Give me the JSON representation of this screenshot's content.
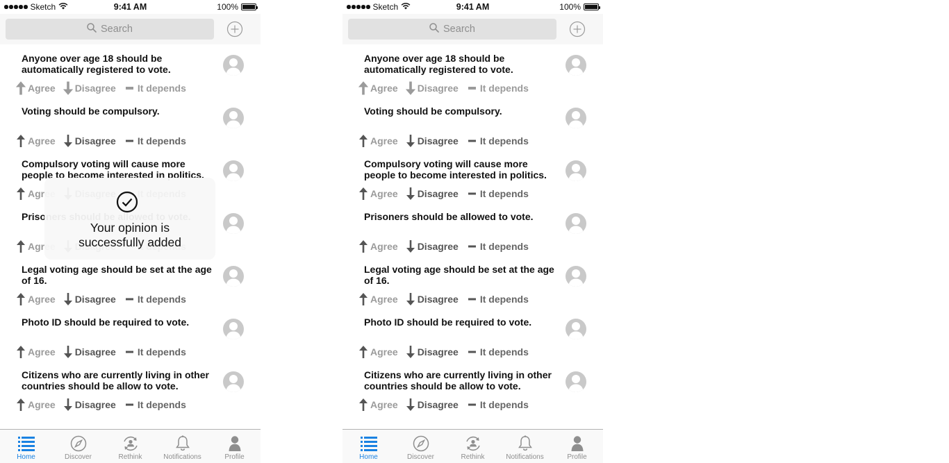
{
  "status_bar": {
    "carrier": "Sketch",
    "time": "9:41 AM",
    "battery": "100%"
  },
  "search": {
    "placeholder": "Search"
  },
  "statements": [
    {
      "text": "Anyone over age 18 should be automatically registered to vote."
    },
    {
      "text": "Voting should be compulsory."
    },
    {
      "text": "Compulsory voting will cause more people to become interested in politics."
    },
    {
      "text": "Prisoners should be allowed to vote."
    },
    {
      "text": "Legal voting age should be set at the age of 16."
    },
    {
      "text": "Photo ID should be required to vote."
    },
    {
      "text": "Citizens who are currently living in other countries should be allow to vote."
    }
  ],
  "actions": {
    "agree": "Agree",
    "disagree": "Disagree",
    "depends": "It depends"
  },
  "toast": {
    "message": "Your opinion is successfully added"
  },
  "tabs": [
    {
      "label": "Home",
      "icon": "list-icon"
    },
    {
      "label": "Discover",
      "icon": "compass-icon"
    },
    {
      "label": "Rethink",
      "icon": "rethink-icon"
    },
    {
      "label": "Notifications",
      "icon": "bell-icon"
    },
    {
      "label": "Profile",
      "icon": "person-icon"
    }
  ],
  "colors": {
    "accent": "#1a82e2",
    "muted": "#9b9b9b"
  }
}
